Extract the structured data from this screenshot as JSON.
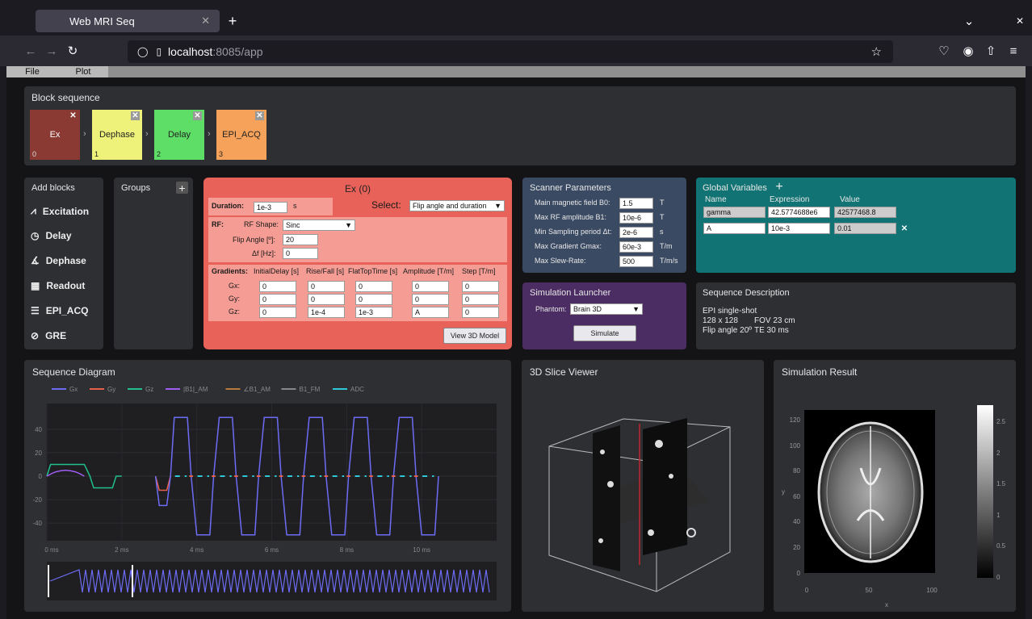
{
  "browser": {
    "tab_title": "Web MRI Seq",
    "url_host": "localhost",
    "url_rest": ":8085/app"
  },
  "menu": {
    "file": "File",
    "plot": "Plot"
  },
  "block_sequence": {
    "title": "Block sequence",
    "blocks": [
      {
        "label": "Ex",
        "index": "0",
        "color": "#8a3a33",
        "text_color": "#ffffff"
      },
      {
        "label": "Dephase",
        "index": "1",
        "color": "#eef27a",
        "text_color": "#222222"
      },
      {
        "label": "Delay",
        "index": "2",
        "color": "#5fde67",
        "text_color": "#222222"
      },
      {
        "label": "EPI_ACQ",
        "index": "3",
        "color": "#f7a25a",
        "text_color": "#222222"
      }
    ]
  },
  "add_blocks": {
    "title": "Add blocks",
    "items": [
      {
        "label": "Excitation",
        "icon": "excitation-icon"
      },
      {
        "label": "Delay",
        "icon": "clock-icon"
      },
      {
        "label": "Dephase",
        "icon": "dephase-icon"
      },
      {
        "label": "Readout",
        "icon": "readout-icon"
      },
      {
        "label": "EPI_ACQ",
        "icon": "epi-icon"
      },
      {
        "label": "GRE",
        "icon": "gre-icon"
      }
    ]
  },
  "groups": {
    "title": "Groups",
    "add": "+"
  },
  "editor": {
    "title": "Ex (0)",
    "duration_label": "Duration:",
    "duration_value": "1e-3",
    "duration_unit": "s",
    "select_label": "Select:",
    "select_value": "Flip angle and duration",
    "rf_label": "RF:",
    "rf_shape_label": "RF Shape:",
    "rf_shape_value": "Sinc",
    "flip_label": "Flip Angle [º]:",
    "flip_value": "20",
    "df_label": "Δf [Hz]:",
    "df_value": "0",
    "grad_headers": [
      "Gradients:",
      "InitialDelay [s]",
      "Rise/Fall [s]",
      "FlatTopTime [s]",
      "Amplitude [T/m]",
      "Step [T/m]"
    ],
    "grad_rows": [
      {
        "axis": "Gx:",
        "values": [
          "0",
          "0",
          "0",
          "0",
          "0"
        ]
      },
      {
        "axis": "Gy:",
        "values": [
          "0",
          "0",
          "0",
          "0",
          "0"
        ]
      },
      {
        "axis": "Gz:",
        "values": [
          "0",
          "1e-4",
          "1e-3",
          "A",
          "0"
        ]
      }
    ],
    "view3d": "View 3D Model"
  },
  "scanner": {
    "title": "Scanner Parameters",
    "rows": [
      {
        "label": "Main magnetic field B0:",
        "value": "1.5",
        "unit": "T"
      },
      {
        "label": "Max RF amplitude B1:",
        "value": "10e-6",
        "unit": "T"
      },
      {
        "label": "Min Sampling period Δt:",
        "value": "2e-6",
        "unit": "s"
      },
      {
        "label": "Max Gradient Gmax:",
        "value": "60e-3",
        "unit": "T/m"
      },
      {
        "label": "Max Slew-Rate:",
        "value": "500",
        "unit": "T/m/s"
      }
    ]
  },
  "globals": {
    "title": "Global Variables",
    "add": "+",
    "headers": [
      "Name",
      "Expression",
      "Value"
    ],
    "rows": [
      {
        "name": "gamma",
        "expr": "42.5774688e6",
        "value": "42577468.8"
      },
      {
        "name": "A",
        "expr": "10e-3",
        "value": "0.01"
      }
    ]
  },
  "launcher": {
    "title": "Simulation Launcher",
    "phantom_label": "Phantom:",
    "phantom_value": "Brain 3D",
    "simulate": "Simulate"
  },
  "description": {
    "title": "Sequence Description",
    "line1": "EPI single-shot",
    "line2a": "128 x 128",
    "line2b": "FOV 23 cm",
    "line3a": "Flip angle 20º",
    "line3b": "TE 30 ms"
  },
  "diagram": {
    "title": "Sequence Diagram",
    "legend": [
      {
        "name": "Gx",
        "color": "#6c6cf5"
      },
      {
        "name": "Gy",
        "color": "#e8604c"
      },
      {
        "name": "Gz",
        "color": "#21c08b"
      },
      {
        "name": "|B1|_AM",
        "color": "#a05ef5"
      },
      {
        "name": "∠B1_AM",
        "color": "#b87a3a"
      },
      {
        "name": "B1_FM",
        "color": "#888888"
      },
      {
        "name": "ADC",
        "color": "#2ec8d8"
      }
    ],
    "y_ticks": [
      "40",
      "20",
      "0",
      "-20",
      "-40"
    ],
    "x_ticks": [
      "0 ms",
      "2 ms",
      "4 ms",
      "6 ms",
      "8 ms",
      "10 ms"
    ]
  },
  "chart_data": {
    "type": "line",
    "xlabel": "",
    "ylabel": "",
    "xlim": [
      0,
      12
    ],
    "ylim": [
      -55,
      55
    ],
    "series": [
      {
        "name": "Gx",
        "values_desc": "EPI readout trapezoids alternating ±50 starting ~3.2 ms, prephaser -25 at ~3.0 ms"
      },
      {
        "name": "Gz",
        "values_desc": "slice select plateau 10 from 0 to 1 ms, rephaser -10 at ~1.3 ms"
      }
    ]
  },
  "slice_viewer": {
    "title": "3D Slice Viewer"
  },
  "sim_result": {
    "title": "Simulation Result",
    "y_ticks": [
      "120",
      "100",
      "80",
      "60",
      "40",
      "20",
      "0"
    ],
    "x_ticks": [
      "0",
      "50",
      "100"
    ],
    "xlabel": "x",
    "ylabel": "y",
    "cbar_ticks": [
      "2.5",
      "2",
      "1.5",
      "1",
      "0.5",
      "0"
    ]
  }
}
